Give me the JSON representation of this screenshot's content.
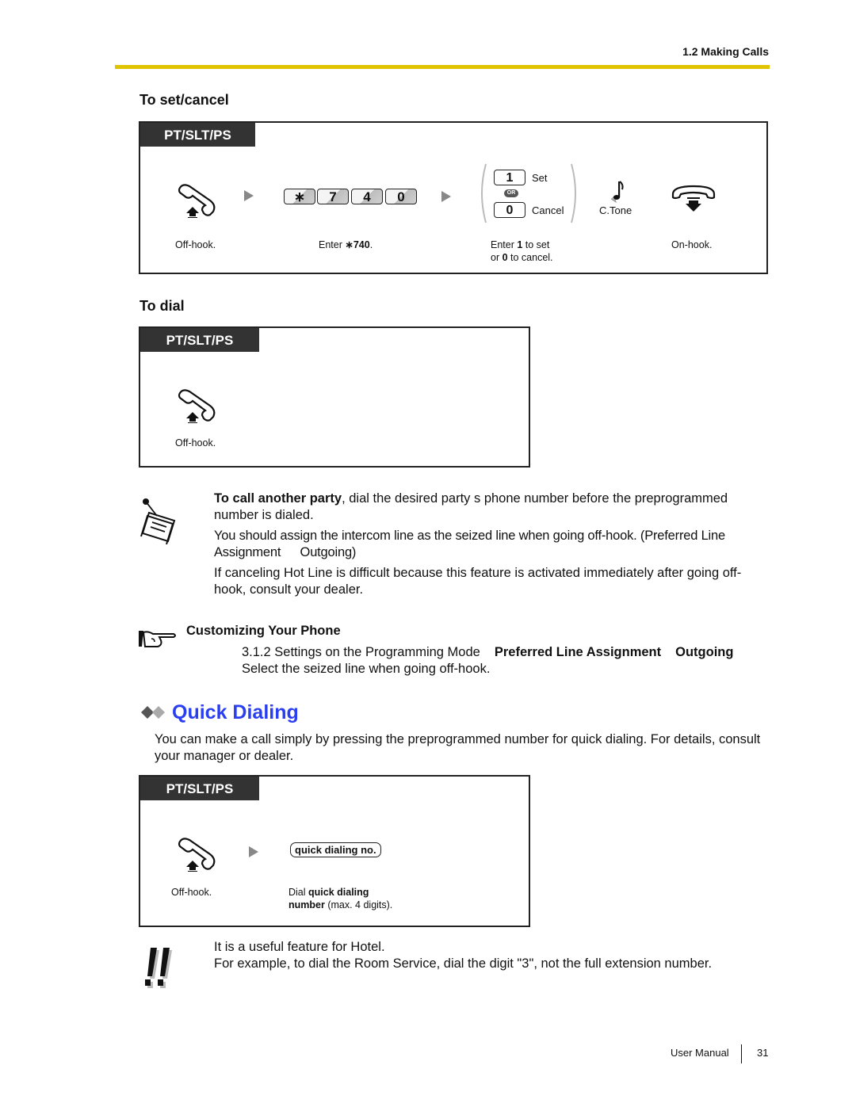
{
  "header": {
    "section": "1.2 Making Calls",
    "accent_color": "#e0c400"
  },
  "set_cancel": {
    "heading": "To set/cancel",
    "tab": "PT/SLT/PS",
    "steps": {
      "offhook_caption": "Off-hook.",
      "keys": [
        "∗",
        "7",
        "4",
        "0"
      ],
      "enter_prefix": "Enter ",
      "enter_code": "∗740",
      "enter_suffix": ".",
      "set_key": "1",
      "set_label": "Set",
      "or_label": "OR",
      "cancel_key": "0",
      "cancel_label": "Cancel",
      "choice_line1_a": "Enter ",
      "choice_line1_b": "1",
      "choice_line1_c": " to set",
      "choice_line2_a": "or ",
      "choice_line2_b": "0",
      "choice_line2_c": " to cancel.",
      "ctone_label": "C.Tone",
      "onhook_caption": "On-hook."
    }
  },
  "to_dial": {
    "heading": "To dial",
    "tab": "PT/SLT/PS",
    "offhook_caption": "Off-hook."
  },
  "notes": {
    "p1_bold": "To call another party",
    "p1_rest": ", dial the desired party s phone number before the preprogrammed number is dialed.",
    "p2": "You should assign the intercom line as the seized line when going off-hook. (Preferred Line Assignment  Outgoing)",
    "p3": "If canceling Hot Line is difficult because this feature is activated immediately after going off-hook, consult your dealer."
  },
  "customizing": {
    "title": "Customizing Your Phone",
    "ref_plain": "3.1.2 Settings on the Programming Mode",
    "ref_bold1": "Preferred Line Assignment",
    "ref_bold2": "Outgoing",
    "desc": "Select the seized line when going off-hook."
  },
  "quick_dialing": {
    "title": "Quick Dialing",
    "title_color": "#2a3ff0",
    "intro": "You can make a call simply by pressing the preprogrammed number for quick dialing. For details, consult your manager or dealer.",
    "tab": "PT/SLT/PS",
    "offhook_caption": "Off-hook.",
    "pill_label": "quick dialing no.",
    "dial_a": "Dial ",
    "dial_b": "quick dialing",
    "dial_c": "number",
    "dial_d": " (max. 4 digits)."
  },
  "warning": {
    "line1": "It is a useful feature for Hotel.",
    "line2": "For example, to dial the Room Service, dial the digit \"3\", not the full extension number."
  },
  "footer": {
    "label": "User Manual",
    "page": "31"
  }
}
